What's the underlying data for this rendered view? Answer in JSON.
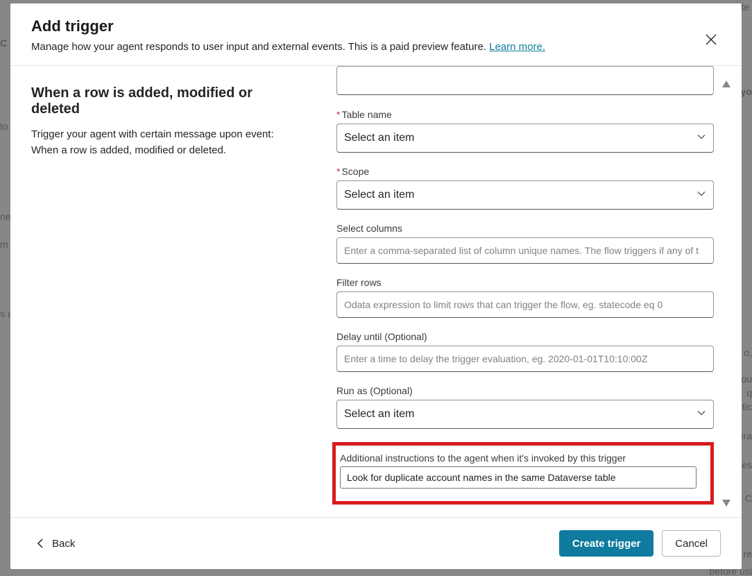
{
  "header": {
    "title": "Add trigger",
    "subtitle_text": "Manage how your agent responds to user input and external events. This is a paid preview feature. ",
    "learn_more": "Learn more."
  },
  "left": {
    "title": "When a row is added, modified or deleted",
    "description": "Trigger your agent with certain message upon event: When a row is added, modified or deleted."
  },
  "form": {
    "table_name": {
      "label": "Table name",
      "placeholder": "Select an item"
    },
    "scope": {
      "label": "Scope",
      "placeholder": "Select an item"
    },
    "select_columns": {
      "label": "Select columns",
      "placeholder": "Enter a comma-separated list of column unique names. The flow triggers if any of t"
    },
    "filter_rows": {
      "label": "Filter rows",
      "placeholder": "Odata expression to limit rows that can trigger the flow, eg. statecode eq 0"
    },
    "delay_until": {
      "label": "Delay until (Optional)",
      "placeholder": "Enter a time to delay the trigger evaluation, eg. 2020-01-01T10:10:00Z"
    },
    "run_as": {
      "label": "Run as (Optional)",
      "placeholder": "Select an item"
    },
    "additional_instructions": {
      "label": "Additional instructions to the agent when it's invoked by this trigger",
      "value": "Look for duplicate account names in the same Dataverse table"
    }
  },
  "footer": {
    "back": "Back",
    "create": "Create trigger",
    "cancel": "Cancel"
  },
  "bg": {
    "t1": "te",
    "t2": "C",
    "t3": "to",
    "t4": "ne",
    "t5": "m",
    "t6": "s a",
    "t7": "yo",
    "t8": "o,",
    "t9": "ou",
    "t10": "q",
    "t11": "tic",
    "t12": "era",
    "t13": "tes",
    "t14": "n C",
    "t15": "re",
    "t16": "before usi"
  }
}
